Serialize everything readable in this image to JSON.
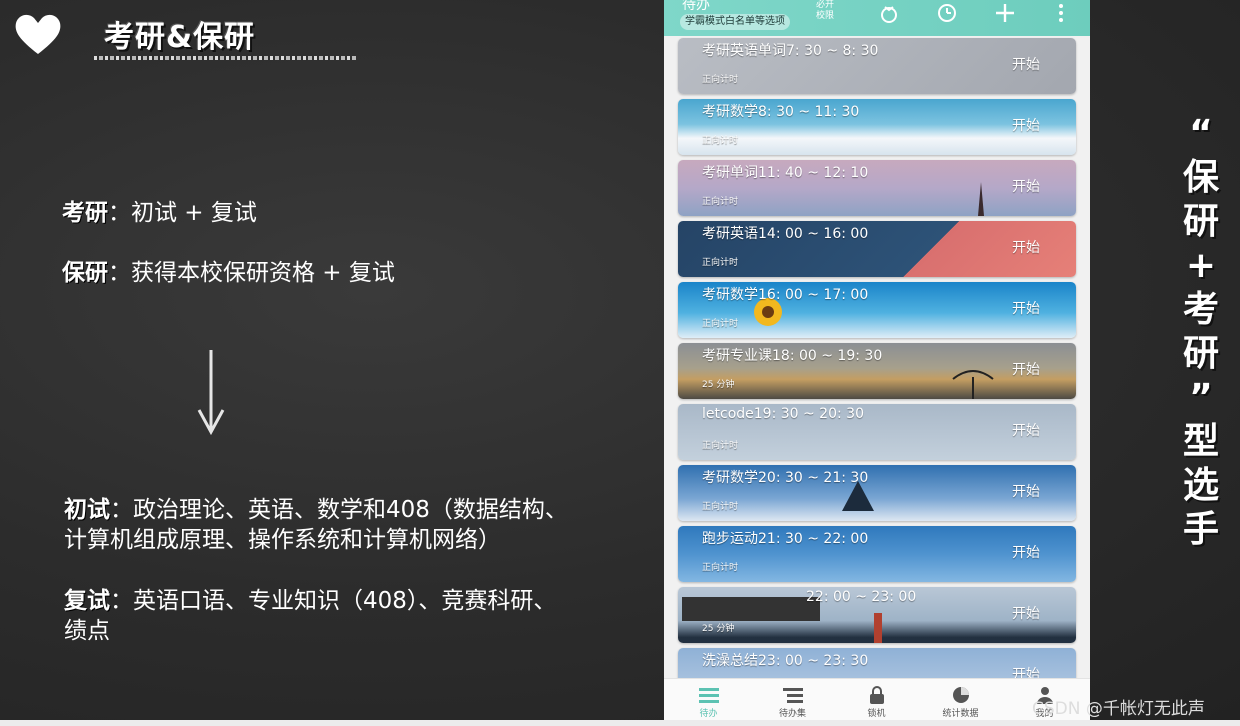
{
  "slide": {
    "title": "考研&保研",
    "lines": [
      {
        "label": "考研",
        "sep": "：",
        "text": "初试 + 复试"
      },
      {
        "label": "保研",
        "sep": "：",
        "text": "获得本校保研资格 + 复试"
      },
      {
        "label": "初试",
        "sep": "：",
        "text": "政治理论、英语、数学和408（数据结构、",
        "text2": "计算机组成原理、操作系统和计算机网络）"
      },
      {
        "label": "复试",
        "sep": "：",
        "text": "英语口语、专业知识（408）、竞赛科研、",
        "text2": "绩点"
      }
    ],
    "side_text": [
      "“",
      "保",
      "研",
      "+",
      "考",
      "研",
      "”",
      "型",
      "选",
      "手"
    ]
  },
  "phone": {
    "header_title": "待办",
    "whitelist_label": "学霸模式白名单等选项",
    "must_label": "必开校限",
    "icons": [
      "tomato-icon",
      "alarm-icon",
      "plus-icon",
      "more-icon"
    ],
    "tasks": [
      {
        "title": "考研英语单词7:  30 ~ 8:  30",
        "sub": "正向计时",
        "start": "开始"
      },
      {
        "title": "考研数学8:  30 ~ 11:  30",
        "sub": "正向计时",
        "start": "开始"
      },
      {
        "title": "考研单词11:  40 ~ 12:  10",
        "sub": "正向计时",
        "start": "开始"
      },
      {
        "title": "考研英语14:  00 ~ 16:  00",
        "sub": "正向计时",
        "start": "开始"
      },
      {
        "title": "考研数学16:  00 ~ 17:  00",
        "sub": "正向计时",
        "start": "开始"
      },
      {
        "title": "考研专业课18:  00 ~ 19:  30",
        "sub": "25 分钟",
        "start": "开始"
      },
      {
        "title": "letcode19:  30 ~ 20:  30",
        "sub": "正向计时",
        "start": "开始"
      },
      {
        "title": "考研数学20:  30 ~ 21:  30",
        "sub": "正向计时",
        "start": "开始"
      },
      {
        "title": "跑步运动21:  30 ~ 22:  00",
        "sub": "正向计时",
        "start": "开始"
      },
      {
        "title": "22:  00 ~ 23:  00",
        "sub": "25 分钟",
        "start": "开始"
      },
      {
        "title": "洗澡总结23:  00 ~ 23:  30",
        "sub": "",
        "start": "开始"
      }
    ],
    "nav": [
      {
        "label": "待办",
        "icon": "list-icon",
        "active": true
      },
      {
        "label": "待办集",
        "icon": "collection-icon",
        "active": false
      },
      {
        "label": "锁机",
        "icon": "lock-icon",
        "active": false
      },
      {
        "label": "统计数据",
        "icon": "pie-chart-icon",
        "active": false
      },
      {
        "label": "我的",
        "icon": "user-icon",
        "active": false
      }
    ]
  },
  "watermark": "CSDN @千帐灯无此声",
  "colors": {
    "accent": "#6dcdbd",
    "board": "#2c2c2c"
  }
}
